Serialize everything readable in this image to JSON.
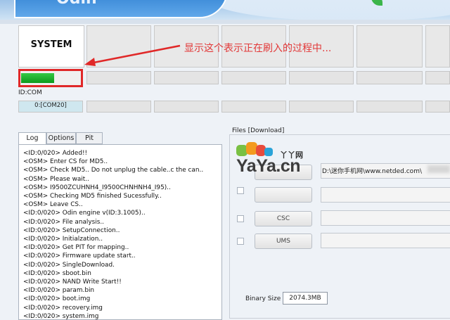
{
  "banner": {
    "logo_text": "Odin"
  },
  "id_slots": [
    {
      "label": "SYSTEM"
    },
    {
      "label": ""
    },
    {
      "label": ""
    },
    {
      "label": ""
    },
    {
      "label": ""
    },
    {
      "label": ""
    },
    {
      "label": ""
    },
    {
      "label": ""
    }
  ],
  "annotation": {
    "text": "显示这个表示正在刷入的过程中...",
    "color": "#e23838"
  },
  "progress": {
    "slot1_fraction": 0.55,
    "fill_color": "#1fb12f"
  },
  "idcom": {
    "label": "ID:COM",
    "port": "0:[COM20]"
  },
  "tabs": {
    "log": "Log",
    "options": "Options",
    "pit": "Pit"
  },
  "log_lines": [
    "<ID:0/020> Added!!",
    "<OSM> Enter CS for MD5..",
    "<OSM> Check MD5.. Do not unplug the cable..c the can..",
    "<OSM> Please wait..",
    "<OSM> I9500ZCUHNH4_I9500CHNHNH4_I95)..",
    "<OSM> Checking MD5 finished Sucessfully..",
    "<OSM> Leave CS..",
    "<ID:0/020> Odin engine v(ID:3.1005)..",
    "<ID:0/020> File analysis..",
    "<ID:0/020> SetupConnection..",
    "<ID:0/020> Initialzation..",
    "<ID:0/020> Get PIT for mapping..",
    "<ID:0/020> Firmware update start..",
    "<ID:0/020> SingleDownload.",
    "<ID:0/020> sboot.bin",
    "<ID:0/020> NAND Write Start!!",
    "<ID:0/020> param.bin",
    "<ID:0/020> boot.img",
    "<ID:0/020> recovery.img",
    "<ID:0/020> system.img"
  ],
  "files": {
    "title": "Files [Download]",
    "path": "D:\\迷你手机网\\www.netded.com\\",
    "csc_label": "CSC",
    "ums_label": "UMS"
  },
  "binary": {
    "label": "Binary Size",
    "value": "2074.3MB"
  },
  "watermark": {
    "text": "YaYa.cn",
    "cn": "丫丫网"
  }
}
